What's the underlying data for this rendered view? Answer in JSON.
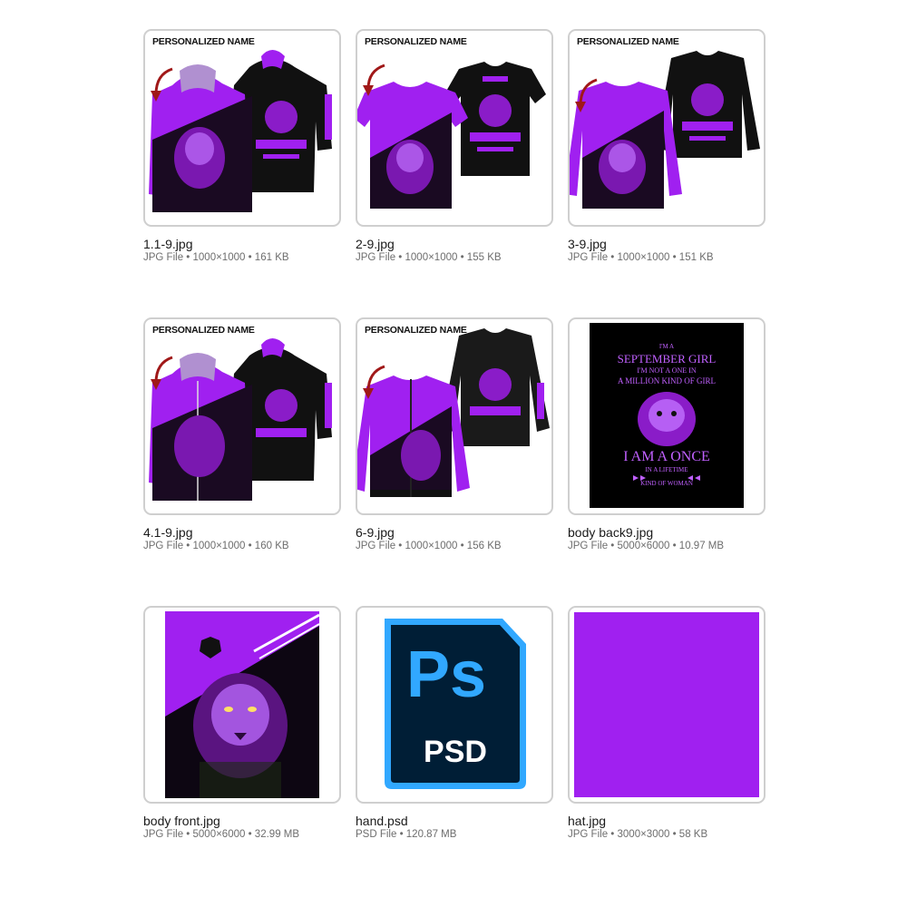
{
  "files": [
    {
      "name": "1.1-9.jpg",
      "meta": "JPG File • 1000×1000 • 161 KB",
      "thumb_label": "PERSONALIZED NAME",
      "thumb_icon": "hoodie-mockup"
    },
    {
      "name": "2-9.jpg",
      "meta": "JPG File • 1000×1000 • 155 KB",
      "thumb_label": "PERSONALIZED NAME",
      "thumb_icon": "tshirt-mockup"
    },
    {
      "name": "3-9.jpg",
      "meta": "JPG File • 1000×1000 • 151 KB",
      "thumb_label": "PERSONALIZED NAME",
      "thumb_icon": "sweatshirt-mockup"
    },
    {
      "name": "4.1-9.jpg",
      "meta": "JPG File • 1000×1000 • 160 KB",
      "thumb_label": "PERSONALIZED NAME",
      "thumb_icon": "zip-hoodie-mockup"
    },
    {
      "name": "6-9.jpg",
      "meta": "JPG File • 1000×1000 • 156 KB",
      "thumb_label": "PERSONALIZED NAME",
      "thumb_icon": "bomber-jacket-mockup"
    },
    {
      "name": "body back9.jpg",
      "meta": "JPG File • 5000×6000 • 10.97 MB",
      "thumb_icon": "tiger-print-artwork",
      "artwork_text": [
        "I'M A",
        "SEPTEMBER GIRL",
        "I'M NOT A ONE IN",
        "A MILLION KIND OF GIRL",
        "I AM A ONCE",
        "IN A LIFETIME",
        "KIND OF WOMAN"
      ]
    },
    {
      "name": "body front.jpg",
      "meta": "JPG File • 5000×6000 • 32.99 MB",
      "thumb_icon": "lion-print-artwork"
    },
    {
      "name": "hand.psd",
      "meta": "PSD File • 120.87 MB",
      "thumb_icon": "photoshop-icon",
      "ps_logo": "Ps",
      "ps_ext": "PSD"
    },
    {
      "name": "hat.jpg",
      "meta": "JPG File • 3000×3000 • 58 KB",
      "thumb_icon": "purple-swatch"
    }
  ],
  "colors": {
    "purple": "#a020f0",
    "purple_light": "#c060ff",
    "black": "#111111",
    "ps_blue": "#31a8ff",
    "ps_dark": "#001e36",
    "arrow_red": "#a01818"
  }
}
